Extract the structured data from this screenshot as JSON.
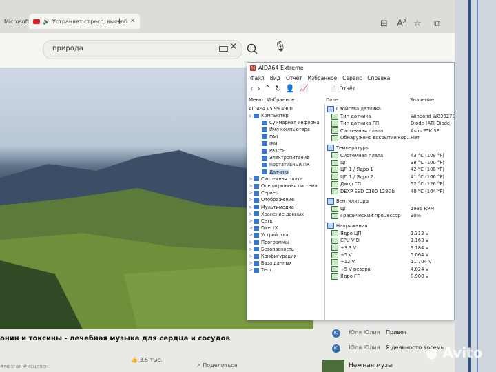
{
  "browser": {
    "tabs": [
      {
        "label": "Microsoft"
      },
      {
        "label": "Устраняет стресс, высвоб"
      }
    ],
    "new_tab": "+",
    "search": {
      "value": "природа"
    },
    "clear": "✕"
  },
  "video": {
    "title": "онин и токсины - лечебная музыка для сердца и сосудов",
    "likes": "3,5 тыс.",
    "share": "Поделиться",
    "hashtags": "#мозгая #исцелен"
  },
  "chat": [
    {
      "avatar": "Ю",
      "author": "Юля Юлия",
      "text": "Привет"
    },
    {
      "avatar": "Ю",
      "author": "Юля Юлия",
      "text": "Я деявносто восемь"
    }
  ],
  "next_video": "Нежная музы",
  "aida": {
    "title": "AIDA64 Extreme",
    "menu": [
      "Файл",
      "Вид",
      "Отчёт",
      "Избранное",
      "Сервис",
      "Справка"
    ],
    "report_label": "Отчёт",
    "left_tabs": [
      "Меню",
      "Избранное"
    ],
    "version": "AIDA64 v5.99.4900",
    "tree": [
      {
        "label": "Компьютер",
        "level": 1,
        "expand": "v"
      },
      {
        "label": "Суммарная информа",
        "level": 2
      },
      {
        "label": "Имя компьютера",
        "level": 2
      },
      {
        "label": "DMI",
        "level": 2
      },
      {
        "label": "IPMI",
        "level": 2
      },
      {
        "label": "Разгон",
        "level": 2
      },
      {
        "label": "Электропитание",
        "level": 2
      },
      {
        "label": "Портативный ПК",
        "level": 2
      },
      {
        "label": "Датчики",
        "level": 2,
        "selected": true
      },
      {
        "label": "Системная плата",
        "level": 1,
        "expand": ">"
      },
      {
        "label": "Операционная система",
        "level": 1,
        "expand": ">"
      },
      {
        "label": "Сервер",
        "level": 1,
        "expand": ">"
      },
      {
        "label": "Отображение",
        "level": 1,
        "expand": ">"
      },
      {
        "label": "Мультимедиа",
        "level": 1,
        "expand": ">"
      },
      {
        "label": "Хранение данных",
        "level": 1,
        "expand": ">"
      },
      {
        "label": "Сеть",
        "level": 1,
        "expand": ">"
      },
      {
        "label": "DirectX",
        "level": 1,
        "expand": ">"
      },
      {
        "label": "Устройства",
        "level": 1,
        "expand": ">"
      },
      {
        "label": "Программы",
        "level": 1,
        "expand": ">"
      },
      {
        "label": "Безопасность",
        "level": 1,
        "expand": ">"
      },
      {
        "label": "Конфигурация",
        "level": 1,
        "expand": ">"
      },
      {
        "label": "База данных",
        "level": 1,
        "expand": ">"
      },
      {
        "label": "Тест",
        "level": 1,
        "expand": ">"
      }
    ],
    "columns": {
      "field": "Поле",
      "value": "Значение"
    },
    "rows": [
      {
        "field": "Свойства датчика",
        "value": "",
        "section": true
      },
      {
        "field": "Тип датчика",
        "value": "Winbond W83627DHG"
      },
      {
        "field": "Тип датчика ГП",
        "value": "Diode  (ATI-Diode)"
      },
      {
        "field": "Системная плата",
        "value": "Asus P5K SE"
      },
      {
        "field": "Обнаружено вскрытие кор...",
        "value": "Нет"
      },
      {
        "field": "Температуры",
        "value": "",
        "section": true
      },
      {
        "field": "Системная плата",
        "value": "43 °C  (109 °F)"
      },
      {
        "field": "ЦП",
        "value": "38 °C  (100 °F)"
      },
      {
        "field": "ЦП 1 / Ядро 1",
        "value": "42 °C  (108 °F)"
      },
      {
        "field": "ЦП 1 / Ядро 2",
        "value": "41 °C  (106 °F)"
      },
      {
        "field": "Диод ГП",
        "value": "52 °C  (126 °F)"
      },
      {
        "field": "DEXP SSD C100 128Gb",
        "value": "40 °C  (104 °F)"
      },
      {
        "field": "Вентиляторы",
        "value": "",
        "section": true
      },
      {
        "field": "ЦП",
        "value": "1985 RPM"
      },
      {
        "field": "Графический процессор",
        "value": "30%"
      },
      {
        "field": "Напряжения",
        "value": "",
        "section": true
      },
      {
        "field": "Ядро ЦП",
        "value": "1.312 V"
      },
      {
        "field": "CPU VID",
        "value": "1.163 V"
      },
      {
        "field": "+3.3 V",
        "value": "3.184 V"
      },
      {
        "field": "+5 V",
        "value": "5.064 V"
      },
      {
        "field": "+12 V",
        "value": "11.704 V"
      },
      {
        "field": "+5 V резерв",
        "value": "4.824 V"
      },
      {
        "field": "Ядро ГП",
        "value": "0.900 V"
      }
    ]
  },
  "watermark": "Avito"
}
